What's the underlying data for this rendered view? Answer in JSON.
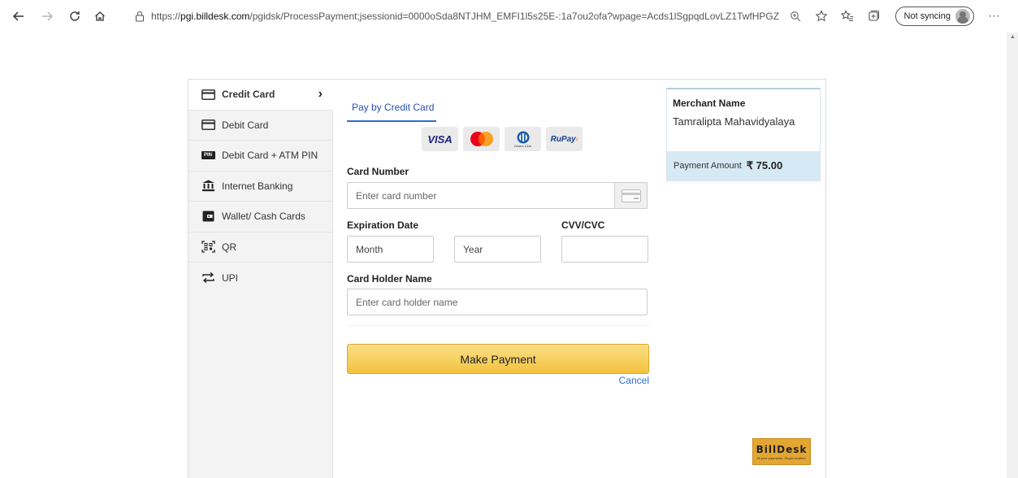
{
  "browser": {
    "url_prefix": "https://",
    "url_host": "pgi.billdesk.com",
    "url_path": "/pgidsk/ProcessPayment;jsessionid=0000oSda8NTJHM_EMFI1l5s25E-:1a7ou2ofa?wpage=Acds1lSgpqdLovLZ1TwfHPGZ",
    "sync_label": "Not syncing",
    "more_label": "···"
  },
  "sidebar": {
    "items": [
      {
        "label": "Credit Card",
        "icon": "credit-card-icon",
        "active": true
      },
      {
        "label": "Debit Card",
        "icon": "debit-card-icon",
        "active": false
      },
      {
        "label": "Debit Card + ATM PIN",
        "icon": "pin-icon",
        "active": false
      },
      {
        "label": "Internet Banking",
        "icon": "bank-icon",
        "active": false
      },
      {
        "label": "Wallet/ Cash Cards",
        "icon": "wallet-icon",
        "active": false
      },
      {
        "label": "QR",
        "icon": "qr-icon",
        "active": false
      },
      {
        "label": "UPI",
        "icon": "upi-icon",
        "active": false
      }
    ],
    "pin_badge": "PIN"
  },
  "form": {
    "tab_label": "Pay by Credit Card",
    "logos": {
      "visa": "VISA",
      "diners": "Diners Club",
      "rupay": "RuPay"
    },
    "card_number_label": "Card Number",
    "card_number_placeholder": "Enter card number",
    "expiration_label": "Expiration Date",
    "month_value": "Month",
    "year_value": "Year",
    "cvv_label": "CVV/CVC",
    "holder_label": "Card Holder Name",
    "holder_placeholder": "Enter card holder name",
    "pay_button": "Make Payment",
    "cancel_link": "Cancel"
  },
  "merchant": {
    "label": "Merchant Name",
    "name": "Tamralipta Mahavidyalaya",
    "amount_label": "Payment Amount",
    "amount_value": "₹ 75.00"
  },
  "brand": {
    "name": "BillDesk",
    "tagline": "All your payments. Single location."
  },
  "colors": {
    "accent_blue": "#2a6fd1",
    "pay_button": "#f3c23f",
    "amount_bar": "#d6eaf5",
    "sidebar_bg": "#f3f3f3",
    "billdesk_orange": "#e4a632"
  }
}
